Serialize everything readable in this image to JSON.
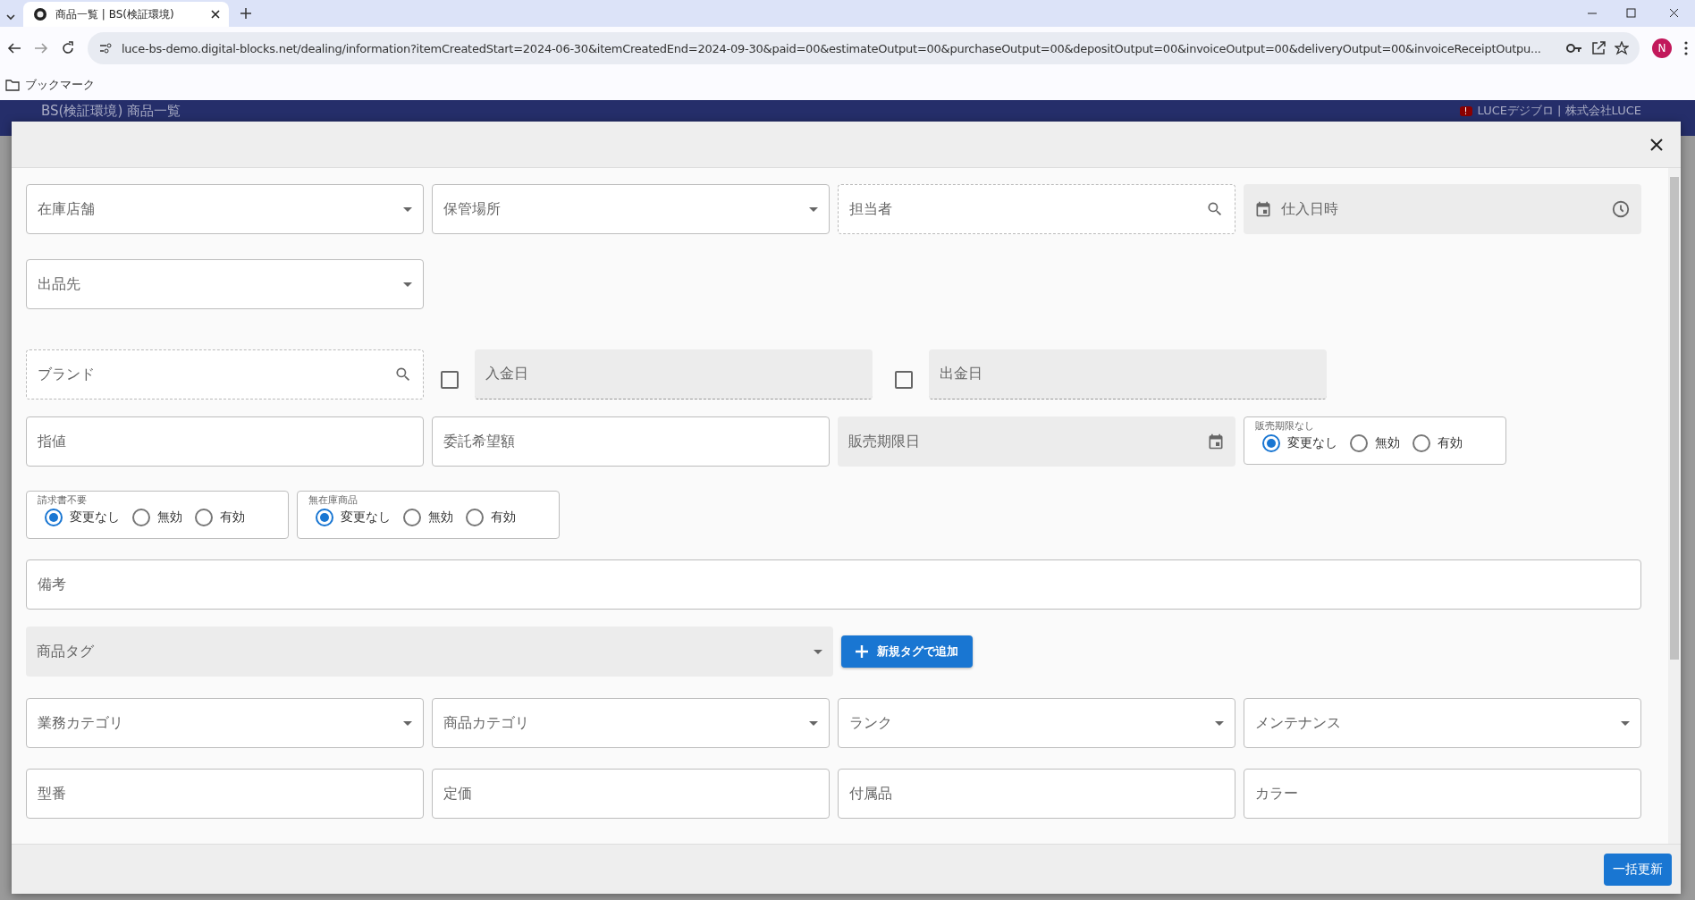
{
  "browser": {
    "tab_title": "商品一覧 | BS(検証環境)",
    "url": "luce-bs-demo.digital-blocks.net/dealing/information?itemCreatedStart=2024-06-30&itemCreatedEnd=2024-09-30&paid=00&estimateOutput=00&purchaseOutput=00&depositOutput=00&invoiceOutput=00&deliveryOutput=00&invoiceReceiptOutpu...",
    "bookmarks_label": "ブックマーク",
    "profile_initial": "N"
  },
  "app_header": {
    "title": "BS(検証環境) 商品一覧",
    "badge": "!",
    "user": "LUCEデジブロ | 株式会社LUCE"
  },
  "dialog": {
    "rows": [
      [
        {
          "kind": "select",
          "label": "在庫店舗"
        },
        {
          "kind": "select",
          "label": "保管場所"
        },
        {
          "kind": "search",
          "label": "担当者"
        },
        {
          "kind": "datetime",
          "label": "仕入日時"
        }
      ],
      [
        {
          "kind": "select",
          "label": "出品先"
        }
      ],
      [
        {
          "kind": "search",
          "label": "ブランド"
        },
        {
          "kind": "checkdate",
          "label": "入金日",
          "checked": false
        },
        {
          "kind": "checkdate",
          "label": "出金日",
          "checked": false
        }
      ],
      [
        {
          "kind": "text",
          "label": "指値"
        },
        {
          "kind": "text",
          "label": "委託希望額"
        },
        {
          "kind": "date",
          "label": "販売期限日"
        },
        {
          "kind": "radio",
          "label": "販売期限なし",
          "options": [
            {
              "label": "変更なし",
              "selected": true
            },
            {
              "label": "無効",
              "selected": false
            },
            {
              "label": "有効",
              "selected": false
            }
          ]
        }
      ],
      [
        {
          "kind": "radio",
          "label": "請求書不要",
          "options": [
            {
              "label": "変更なし",
              "selected": true
            },
            {
              "label": "無効",
              "selected": false
            },
            {
              "label": "有効",
              "selected": false
            }
          ]
        },
        {
          "kind": "radio",
          "label": "無在庫商品",
          "options": [
            {
              "label": "変更なし",
              "selected": true
            },
            {
              "label": "無効",
              "selected": false
            },
            {
              "label": "有効",
              "selected": false
            }
          ]
        }
      ],
      [
        {
          "kind": "wide",
          "label": "備考"
        }
      ],
      [
        {
          "kind": "tags",
          "label": "商品タグ",
          "button": "新規タグで追加"
        }
      ],
      [
        {
          "kind": "select",
          "label": "業務カテゴリ"
        },
        {
          "kind": "select",
          "label": "商品カテゴリ"
        },
        {
          "kind": "select",
          "label": "ランク"
        },
        {
          "kind": "select",
          "label": "メンテナンス"
        }
      ],
      [
        {
          "kind": "text",
          "label": "型番"
        },
        {
          "kind": "text",
          "label": "定価"
        },
        {
          "kind": "text",
          "label": "付属品"
        },
        {
          "kind": "text",
          "label": "カラー"
        }
      ]
    ],
    "submit": "一括更新"
  }
}
